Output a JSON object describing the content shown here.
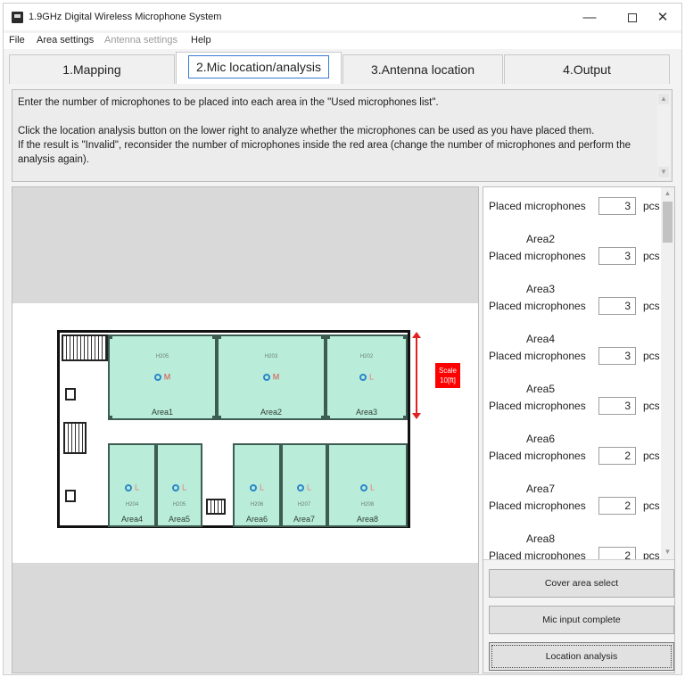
{
  "window": {
    "title": "1.9GHz Digital Wireless Microphone System",
    "minimize": "—",
    "close": "✕"
  },
  "menu": [
    {
      "label": "File",
      "enabled": true
    },
    {
      "label": "Area settings",
      "enabled": true
    },
    {
      "label": "Antenna settings",
      "enabled": false
    },
    {
      "label": "Help",
      "enabled": true
    }
  ],
  "tabs": [
    {
      "label": "1.Mapping",
      "active": false
    },
    {
      "label": "2.Mic location/analysis",
      "active": true
    },
    {
      "label": "3.Antenna location",
      "active": false
    },
    {
      "label": "4.Output",
      "active": false
    }
  ],
  "instructions": {
    "line1": "Enter the number of microphones to be placed into each area in the \"Used microphones list\".",
    "line2": "Click the location analysis button on the lower right to analyze whether the microphones can be used as you have placed them.",
    "line3": "If the result is \"Invalid\", reconsider the number of microphones inside the red area (change the number of microphones and perform the analysis again)."
  },
  "map": {
    "scale_line1": "Scale",
    "scale_line2": "10[ft]",
    "rooms": [
      {
        "label": "Area1",
        "code": "H205",
        "mic_type": "M"
      },
      {
        "label": "Area2",
        "code": "H203",
        "mic_type": "M"
      },
      {
        "label": "Area3",
        "code": "H202",
        "mic_type": "L"
      },
      {
        "label": "Area4",
        "code": "H204",
        "mic_type": "L"
      },
      {
        "label": "Area5",
        "code": "H205",
        "mic_type": "L"
      },
      {
        "label": "Area6",
        "code": "H206",
        "mic_type": "L"
      },
      {
        "label": "Area7",
        "code": "H207",
        "mic_type": "L"
      },
      {
        "label": "Area8",
        "code": "H208",
        "mic_type": "L"
      }
    ]
  },
  "mic_list": {
    "row_label": "Placed microphones",
    "unit": "pcs",
    "areas": [
      {
        "name": "",
        "count": "3"
      },
      {
        "name": "Area2",
        "count": "3"
      },
      {
        "name": "Area3",
        "count": "3"
      },
      {
        "name": "Area4",
        "count": "3"
      },
      {
        "name": "Area5",
        "count": "3"
      },
      {
        "name": "Area6",
        "count": "2"
      },
      {
        "name": "Area7",
        "count": "2"
      },
      {
        "name": "Area8",
        "count": "2"
      }
    ]
  },
  "buttons": {
    "cover_area": "Cover area select",
    "mic_input": "Mic input complete",
    "location_analysis": "Location analysis"
  }
}
